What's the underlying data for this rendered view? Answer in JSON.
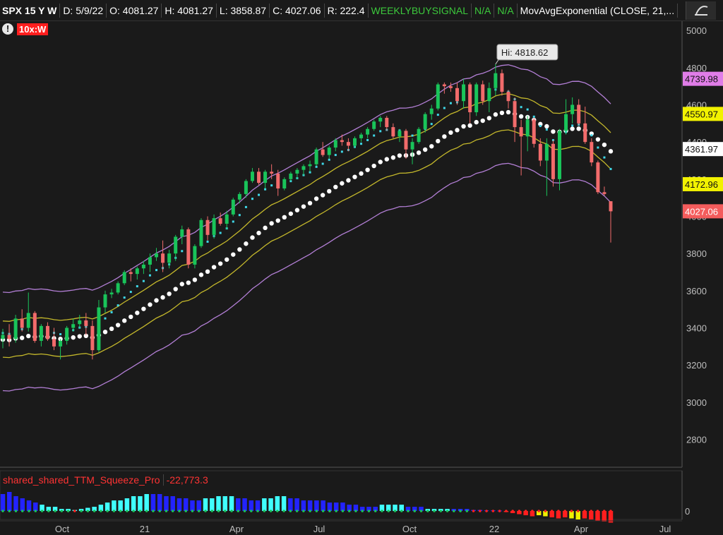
{
  "header": {
    "symbol": "SPX 15 Y W",
    "date": "D: 5/9/22",
    "open": "O: 4081.27",
    "high": "H: 4081.27",
    "low": "L: 3858.87",
    "close": "C: 4027.06",
    "range": "R: 222.4",
    "study": "WEEKLYBUYSIGNAL",
    "na1": "N/A",
    "na2": "N/A",
    "mavg": "MovAvgExponential (CLOSE, 21,..."
  },
  "badge": "10x:W",
  "alert_glyph": "!",
  "lower_study": {
    "name": "shared_shared_TTM_Squeeze_Pro",
    "value": "-22,773.3"
  },
  "colors": {
    "up": "#19c45a",
    "down": "#f26b6b",
    "upper_band": "#b37fd6",
    "mid_band": "#c4b82b",
    "ema_dots": "#ffffff",
    "cyan_dots": "#3fd8e8",
    "price_tag_purple": "#e07de8",
    "price_tag_yellow": "#f2f200",
    "price_tag_white": "#ffffff",
    "price_tag_red": "#f45c5c"
  },
  "chart_data": {
    "type": "candlestick",
    "ylim": [
      2650,
      5050
    ],
    "y_ticks": [
      5000,
      4800,
      4600,
      4400,
      4200,
      4000,
      3800,
      3600,
      3400,
      3200,
      3000,
      2800
    ],
    "x_ticks": [
      "Oct",
      "21",
      "Apr",
      "Jul",
      "Oct",
      "22",
      "Apr",
      "Jul"
    ],
    "hi_label": "Hi: 4818.62",
    "price_tags": [
      {
        "value": 4739.98,
        "label": "4739.98",
        "color": "purple"
      },
      {
        "value": 4550.97,
        "label": "4550.97",
        "color": "yellow"
      },
      {
        "value": 4361.97,
        "label": "4361.97",
        "color": "white"
      },
      {
        "value": 4172.96,
        "label": "4172.96",
        "color": "yellow"
      },
      {
        "value": 4027.06,
        "label": "4027.06",
        "color": "red"
      }
    ],
    "candles": [
      [
        3340,
        3395,
        3290,
        3362
      ],
      [
        3362,
        3420,
        3300,
        3340
      ],
      [
        3340,
        3470,
        3320,
        3450
      ],
      [
        3450,
        3500,
        3380,
        3400
      ],
      [
        3400,
        3590,
        3380,
        3480
      ],
      [
        3480,
        3490,
        3320,
        3330
      ],
      [
        3330,
        3420,
        3300,
        3410
      ],
      [
        3410,
        3430,
        3330,
        3340
      ],
      [
        3340,
        3400,
        3280,
        3300
      ],
      [
        3300,
        3340,
        3230,
        3330
      ],
      [
        3330,
        3410,
        3310,
        3400
      ],
      [
        3400,
        3450,
        3380,
        3420
      ],
      [
        3420,
        3470,
        3400,
        3440
      ],
      [
        3440,
        3480,
        3360,
        3410
      ],
      [
        3410,
        3440,
        3230,
        3280
      ],
      [
        3280,
        3550,
        3270,
        3510
      ],
      [
        3510,
        3600,
        3480,
        3580
      ],
      [
        3580,
        3610,
        3560,
        3590
      ],
      [
        3590,
        3650,
        3580,
        3640
      ],
      [
        3640,
        3710,
        3630,
        3700
      ],
      [
        3700,
        3720,
        3650,
        3690
      ],
      [
        3690,
        3730,
        3660,
        3720
      ],
      [
        3720,
        3760,
        3690,
        3740
      ],
      [
        3740,
        3800,
        3700,
        3780
      ],
      [
        3780,
        3830,
        3760,
        3800
      ],
      [
        3800,
        3870,
        3700,
        3750
      ],
      [
        3750,
        3820,
        3720,
        3800
      ],
      [
        3800,
        3900,
        3760,
        3890
      ],
      [
        3890,
        3950,
        3850,
        3930
      ],
      [
        3930,
        3940,
        3720,
        3740
      ],
      [
        3740,
        3850,
        3720,
        3840
      ],
      [
        3840,
        3990,
        3830,
        3980
      ],
      [
        3980,
        4000,
        3870,
        3900
      ],
      [
        3900,
        4010,
        3880,
        3990
      ],
      [
        3990,
        4020,
        3950,
        3960
      ],
      [
        3960,
        4030,
        3930,
        4010
      ],
      [
        4010,
        4100,
        4000,
        4090
      ],
      [
        4090,
        4130,
        4070,
        4120
      ],
      [
        4120,
        4200,
        4100,
        4190
      ],
      [
        4190,
        4260,
        4180,
        4240
      ],
      [
        4240,
        4260,
        4170,
        4180
      ],
      [
        4180,
        4250,
        4150,
        4240
      ],
      [
        4240,
        4280,
        4200,
        4230
      ],
      [
        4230,
        4250,
        4110,
        4150
      ],
      [
        4150,
        4210,
        4140,
        4200
      ],
      [
        4200,
        4240,
        4190,
        4230
      ],
      [
        4230,
        4260,
        4200,
        4250
      ],
      [
        4250,
        4280,
        4220,
        4270
      ],
      [
        4270,
        4300,
        4240,
        4280
      ],
      [
        4280,
        4370,
        4270,
        4360
      ],
      [
        4360,
        4400,
        4320,
        4330
      ],
      [
        4330,
        4380,
        4310,
        4370
      ],
      [
        4370,
        4420,
        4350,
        4410
      ],
      [
        4410,
        4440,
        4380,
        4400
      ],
      [
        4400,
        4420,
        4350,
        4380
      ],
      [
        4380,
        4430,
        4370,
        4420
      ],
      [
        4420,
        4450,
        4400,
        4440
      ],
      [
        4440,
        4480,
        4420,
        4470
      ],
      [
        4470,
        4520,
        4460,
        4510
      ],
      [
        4510,
        4540,
        4480,
        4530
      ],
      [
        4530,
        4540,
        4460,
        4480
      ],
      [
        4480,
        4500,
        4420,
        4430
      ],
      [
        4430,
        4470,
        4400,
        4460
      ],
      [
        4460,
        4470,
        4310,
        4360
      ],
      [
        4360,
        4420,
        4280,
        4400
      ],
      [
        4400,
        4480,
        4390,
        4470
      ],
      [
        4470,
        4560,
        4450,
        4550
      ],
      [
        4550,
        4600,
        4520,
        4580
      ],
      [
        4580,
        4720,
        4570,
        4710
      ],
      [
        4710,
        4720,
        4660,
        4700
      ],
      [
        4700,
        4720,
        4670,
        4690
      ],
      [
        4690,
        4720,
        4600,
        4620
      ],
      [
        4620,
        4740,
        4580,
        4710
      ],
      [
        4710,
        4720,
        4500,
        4560
      ],
      [
        4560,
        4720,
        4540,
        4710
      ],
      [
        4710,
        4730,
        4600,
        4620
      ],
      [
        4620,
        4720,
        4560,
        4690
      ],
      [
        4690,
        4818.62,
        4650,
        4770
      ],
      [
        4770,
        4790,
        4650,
        4670
      ],
      [
        4670,
        4680,
        4580,
        4620
      ],
      [
        4620,
        4640,
        4400,
        4480
      ],
      [
        4480,
        4520,
        4220,
        4430
      ],
      [
        4430,
        4540,
        4350,
        4520
      ],
      [
        4520,
        4530,
        4370,
        4390
      ],
      [
        4390,
        4420,
        4270,
        4300
      ],
      [
        4300,
        4420,
        4110,
        4390
      ],
      [
        4390,
        4410,
        4160,
        4200
      ],
      [
        4200,
        4470,
        4140,
        4460
      ],
      [
        4460,
        4630,
        4440,
        4550
      ],
      [
        4550,
        4640,
        4500,
        4600
      ],
      [
        4600,
        4630,
        4490,
        4500
      ],
      [
        4500,
        4590,
        4390,
        4400
      ],
      [
        4400,
        4420,
        4270,
        4290
      ],
      [
        4290,
        4300,
        4120,
        4130
      ],
      [
        4130,
        4160,
        4110,
        4120
      ],
      [
        4081.27,
        4081.27,
        3858.87,
        4027.06
      ]
    ],
    "squeeze_histogram": [
      8,
      9,
      7,
      6,
      5,
      4,
      3,
      2,
      2,
      1,
      1,
      0.5,
      1,
      1.5,
      2,
      3,
      4,
      5,
      5,
      6,
      7,
      7,
      8,
      8,
      8,
      7,
      7,
      6,
      6,
      5,
      5,
      6,
      6,
      7,
      7,
      7,
      6,
      6,
      5,
      5,
      6,
      6,
      7,
      7,
      6,
      6,
      5,
      5,
      5,
      5,
      4,
      4,
      4,
      3,
      3,
      2,
      2,
      2,
      3,
      3,
      3,
      3,
      2,
      2,
      2,
      1,
      1,
      1,
      1,
      1,
      1,
      1,
      0.5,
      0.5,
      0.3,
      0.3,
      0.2,
      -0.5,
      -1,
      -1.5,
      -2,
      -2.5,
      -2,
      -2.5,
      -3,
      -3.5,
      -3,
      -3.5,
      -4,
      -3.5,
      -4,
      -4.5,
      -5,
      -5.5
    ],
    "squeeze_colors": [
      "blue",
      "blue",
      "blue",
      "blue",
      "blue",
      "blue",
      "cyan",
      "cyan",
      "cyan",
      "cyan",
      "cyan",
      "cyan",
      "cyan",
      "cyan",
      "cyan",
      "cyan",
      "cyan",
      "cyan",
      "cyan",
      "cyan",
      "cyan",
      "cyan",
      "cyan",
      "blue",
      "blue",
      "blue",
      "blue",
      "blue",
      "blue",
      "blue",
      "blue",
      "cyan",
      "cyan",
      "cyan",
      "cyan",
      "cyan",
      "blue",
      "blue",
      "blue",
      "blue",
      "cyan",
      "cyan",
      "cyan",
      "cyan",
      "blue",
      "blue",
      "blue",
      "blue",
      "blue",
      "blue",
      "blue",
      "blue",
      "blue",
      "blue",
      "blue",
      "blue",
      "blue",
      "blue",
      "cyan",
      "cyan",
      "cyan",
      "cyan",
      "blue",
      "blue",
      "blue",
      "cyan",
      "cyan",
      "cyan",
      "cyan",
      "blue",
      "blue",
      "blue",
      "blue",
      "blue",
      "blue",
      "blue",
      "blue",
      "red",
      "red",
      "red",
      "red",
      "red",
      "yellow",
      "yellow",
      "red",
      "red",
      "red",
      "yellow",
      "yellow",
      "red",
      "red",
      "red",
      "red",
      "red"
    ]
  }
}
